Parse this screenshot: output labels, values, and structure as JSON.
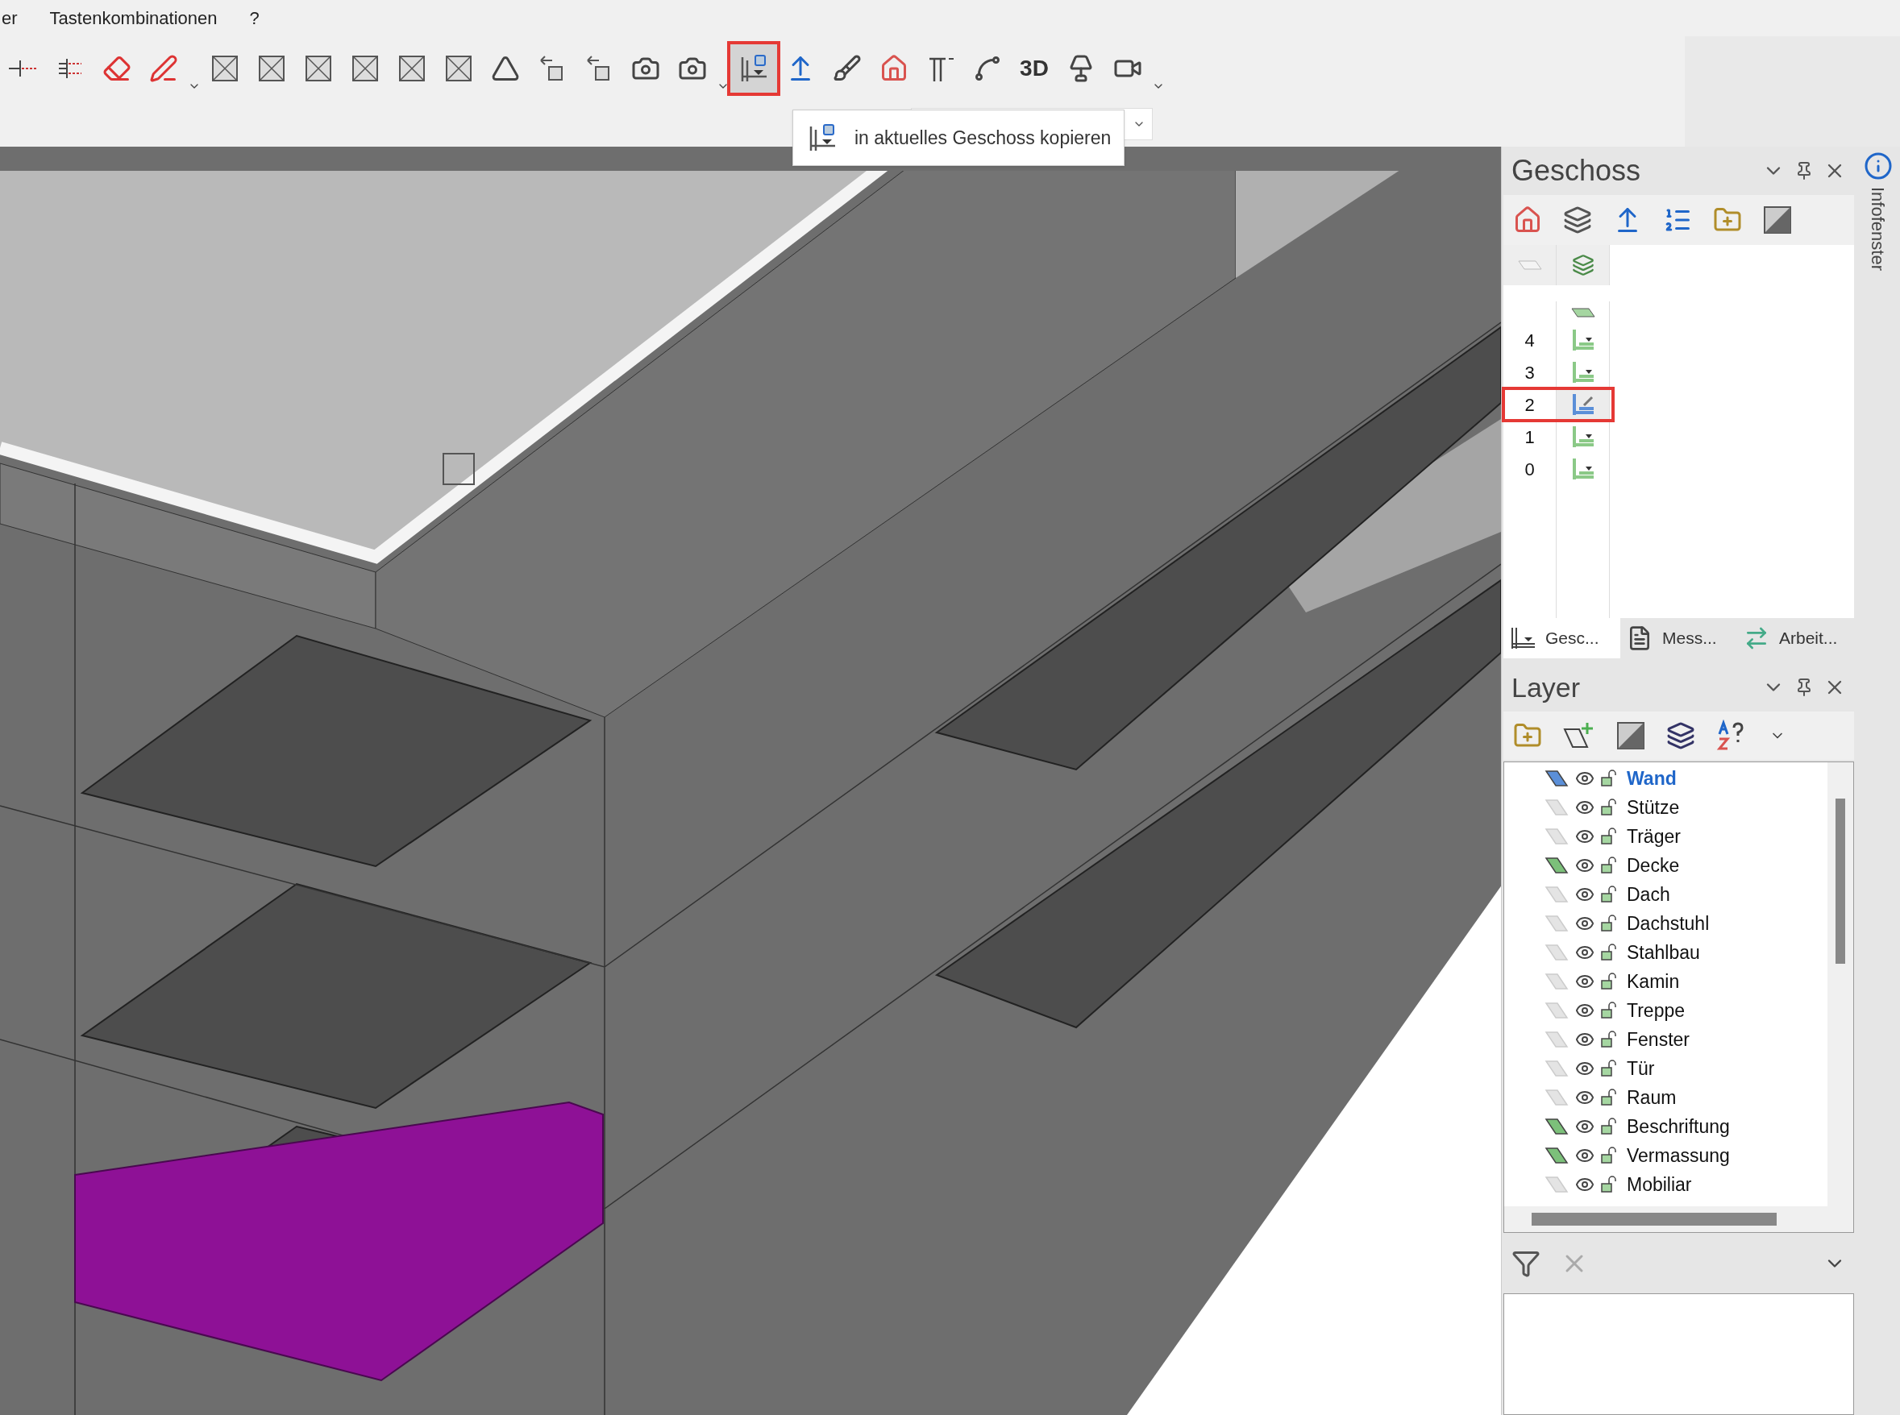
{
  "menu": [
    "er",
    "Tastenkombinationen",
    "?"
  ],
  "toolbar": [
    {
      "kind": "line",
      "highlighted": false
    },
    {
      "kind": "dims",
      "highlighted": false
    },
    {
      "kind": "eraser",
      "highlighted": false
    },
    {
      "kind": "pen",
      "highlighted": false
    },
    {
      "kind": "caret",
      "highlighted": false
    },
    {
      "kind": "view",
      "highlighted": false
    },
    {
      "kind": "view",
      "highlighted": false
    },
    {
      "kind": "view",
      "highlighted": false
    },
    {
      "kind": "view",
      "highlighted": false
    },
    {
      "kind": "view",
      "highlighted": false
    },
    {
      "kind": "view",
      "highlighted": false
    },
    {
      "kind": "pyramid",
      "highlighted": false
    },
    {
      "kind": "move",
      "highlighted": false
    },
    {
      "kind": "move",
      "highlighted": false
    },
    {
      "kind": "camera",
      "highlighted": false
    },
    {
      "kind": "camera",
      "highlighted": false
    },
    {
      "kind": "caret",
      "highlighted": false
    },
    {
      "kind": "copy",
      "highlighted": true
    },
    {
      "kind": "upload",
      "highlighted": false
    },
    {
      "kind": "brush",
      "highlighted": false
    },
    {
      "kind": "home",
      "highlighted": false
    },
    {
      "kind": "column",
      "highlighted": false
    },
    {
      "kind": "curve",
      "highlighted": false
    },
    {
      "kind": "text",
      "label": "3D",
      "highlighted": false
    },
    {
      "kind": "lamp",
      "highlighted": false
    },
    {
      "kind": "video",
      "highlighted": false
    },
    {
      "kind": "caret",
      "highlighted": false
    }
  ],
  "tooltip": "in aktuelles Geschoss kopieren",
  "geschoss": {
    "title": "Geschoss",
    "rows": [
      {
        "kind": "plane"
      },
      {
        "kind": "floor",
        "label": "4",
        "selected": false,
        "highlighted": false
      },
      {
        "kind": "floor",
        "label": "3",
        "selected": false,
        "highlighted": false
      },
      {
        "kind": "floor",
        "label": "2",
        "selected": true,
        "highlighted": true
      },
      {
        "kind": "floor",
        "label": "1",
        "selected": false,
        "highlighted": false
      },
      {
        "kind": "floor",
        "label": "0",
        "selected": false,
        "highlighted": false
      }
    ],
    "tabs": [
      {
        "label": "Gesc...",
        "selected": true
      },
      {
        "label": "Mess...",
        "selected": false
      },
      {
        "label": "Arbeit...",
        "selected": false
      }
    ]
  },
  "layer": {
    "title": "Layer",
    "items": [
      {
        "name": "Wand",
        "current": true
      },
      {
        "name": "Stütze",
        "current": false,
        "marked": false
      },
      {
        "name": "Träger",
        "current": false,
        "marked": false
      },
      {
        "name": "Decke",
        "current": false,
        "marked": true
      },
      {
        "name": "Dach",
        "current": false,
        "marked": false
      },
      {
        "name": "Dachstuhl",
        "current": false,
        "marked": false
      },
      {
        "name": "Stahlbau",
        "current": false,
        "marked": false
      },
      {
        "name": "Kamin",
        "current": false,
        "marked": false
      },
      {
        "name": "Treppe",
        "current": false,
        "marked": false
      },
      {
        "name": "Fenster",
        "current": false,
        "marked": false
      },
      {
        "name": "Tür",
        "current": false,
        "marked": false
      },
      {
        "name": "Raum",
        "current": false,
        "marked": false
      },
      {
        "name": "Beschriftung",
        "current": false,
        "marked": true
      },
      {
        "name": "Vermassung",
        "current": false,
        "marked": true
      },
      {
        "name": "Mobiliar",
        "current": false,
        "marked": false
      }
    ]
  },
  "side_strip": "Infofenster"
}
